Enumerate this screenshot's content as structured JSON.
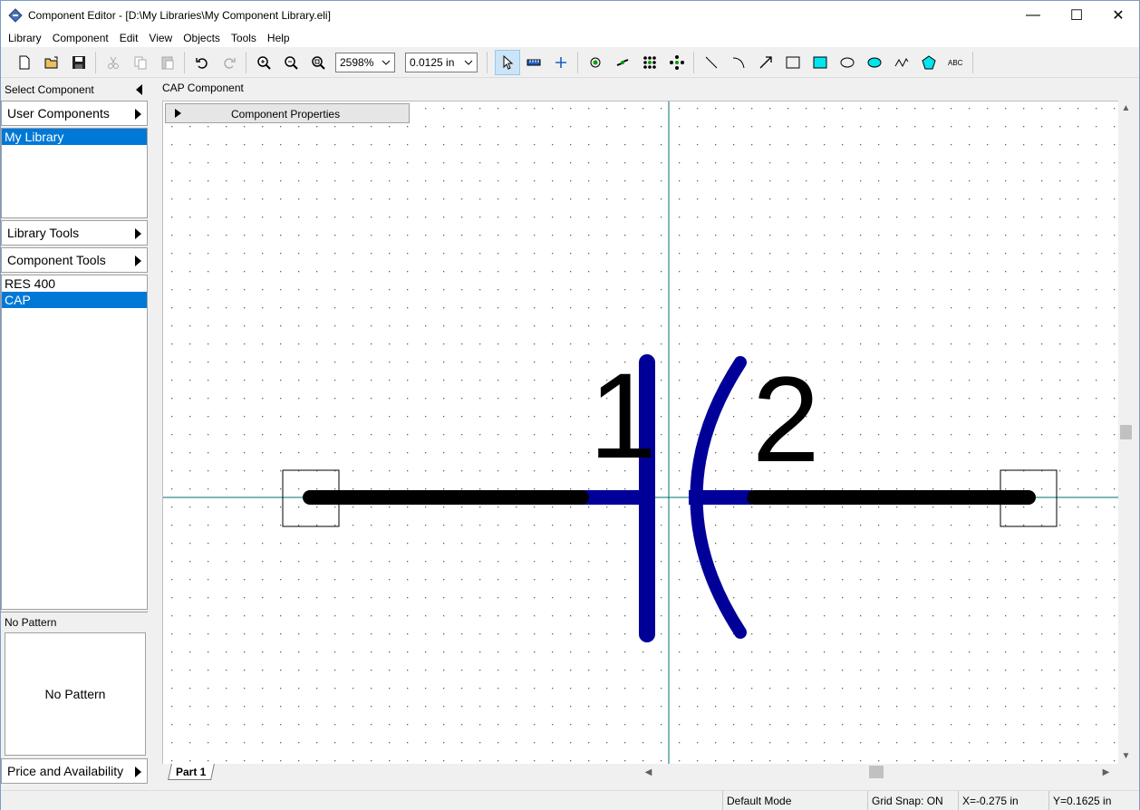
{
  "window": {
    "title": "Component Editor - [D:\\My Libraries\\My Component Library.eli]",
    "minimize": "—",
    "maximize": "☐",
    "close": "✕"
  },
  "menu": [
    "Library",
    "Component",
    "Edit",
    "View",
    "Objects",
    "Tools",
    "Help"
  ],
  "toolbar": {
    "zoom_value": "2598%",
    "grid_value": "0.0125 in",
    "icons": [
      "new-icon",
      "open-icon",
      "save-icon",
      "cut-icon",
      "copy-icon",
      "paste-icon",
      "undo-icon",
      "redo-icon",
      "zoom-in-icon",
      "zoom-out-icon",
      "zoom-fit-icon",
      "select-icon",
      "ruler-icon",
      "crosshair-icon",
      "pin-icon",
      "reverse-pins-icon",
      "pin-array-icon",
      "move-pins-icon",
      "line-icon",
      "arc-icon",
      "arrow-icon",
      "rectangle-icon",
      "filled-rectangle-icon",
      "ellipse-icon",
      "filled-ellipse-icon",
      "bezier-icon",
      "polygon-icon",
      "text-icon"
    ]
  },
  "left_panel": {
    "select_component": "Select Component",
    "user_components": "User Components",
    "libraries": [
      "My Library"
    ],
    "library_tools": "Library Tools",
    "component_tools": "Component Tools",
    "components": [
      "RES 400",
      "CAP"
    ],
    "pattern_header": "No Pattern",
    "pattern_preview": "No Pattern",
    "price_availability": "Price and Availability"
  },
  "editor": {
    "doc_title": "CAP Component",
    "properties_label": "Component Properties",
    "pin_label_1": "1",
    "pin_label_2": "2",
    "tab_label": "Part 1"
  },
  "status": {
    "mode": "Default Mode",
    "grid_snap": "Grid Snap: ON",
    "x": "X=-0.275 in",
    "y": "Y=0.1625 in"
  },
  "colors": {
    "selection": "#0078d7",
    "body": "#000099",
    "lead": "#000000",
    "crosshair": "#007070",
    "fill_cyan": "#00e5ee"
  }
}
